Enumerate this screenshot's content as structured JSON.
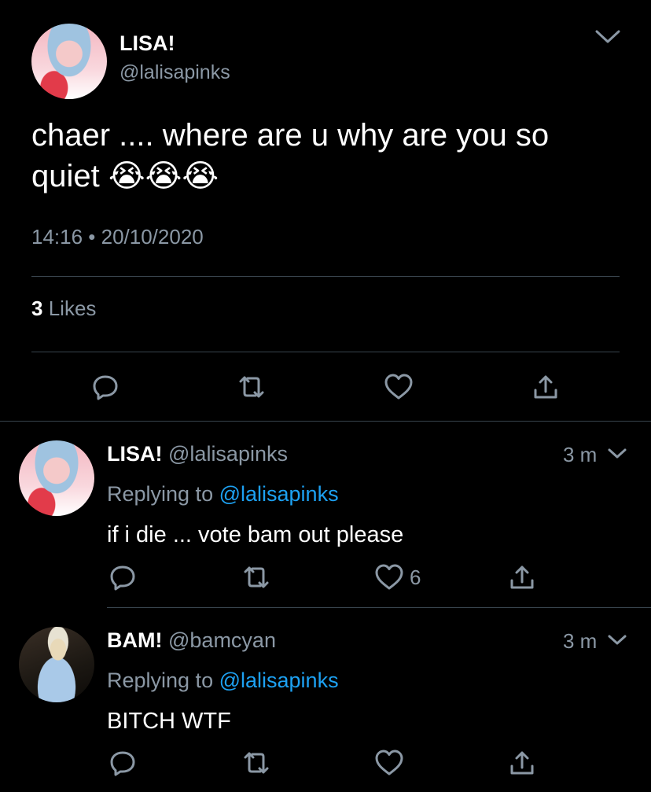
{
  "main_tweet": {
    "author_name": "LISA!",
    "author_handle": "@lalisapinks",
    "text": "chaer .... where are u why are you so quiet 😭😭😭",
    "timestamp": "14:16 • 20/10/2020",
    "likes_count": "3",
    "likes_label": "Likes",
    "avatar_icon": "avatar-lisa"
  },
  "replies": [
    {
      "author_name": "LISA!",
      "author_handle": "@lalisapinks",
      "time": "3 m",
      "replying_label": "Replying to",
      "replying_to": "@lalisapinks",
      "text": "if i die ... vote bam out please",
      "like_count": "6",
      "avatar_icon": "avatar-lisa"
    },
    {
      "author_name": "BAM!",
      "author_handle": "@bamcyan",
      "time": "3 m",
      "replying_label": "Replying to",
      "replying_to": "@lalisapinks",
      "text": "BITCH WTF",
      "like_count": "",
      "avatar_icon": "avatar-bam"
    }
  ],
  "colors": {
    "background": "#000000",
    "text": "#ffffff",
    "muted": "#8b98a5",
    "link": "#1da1f2",
    "divider": "#38444d"
  }
}
